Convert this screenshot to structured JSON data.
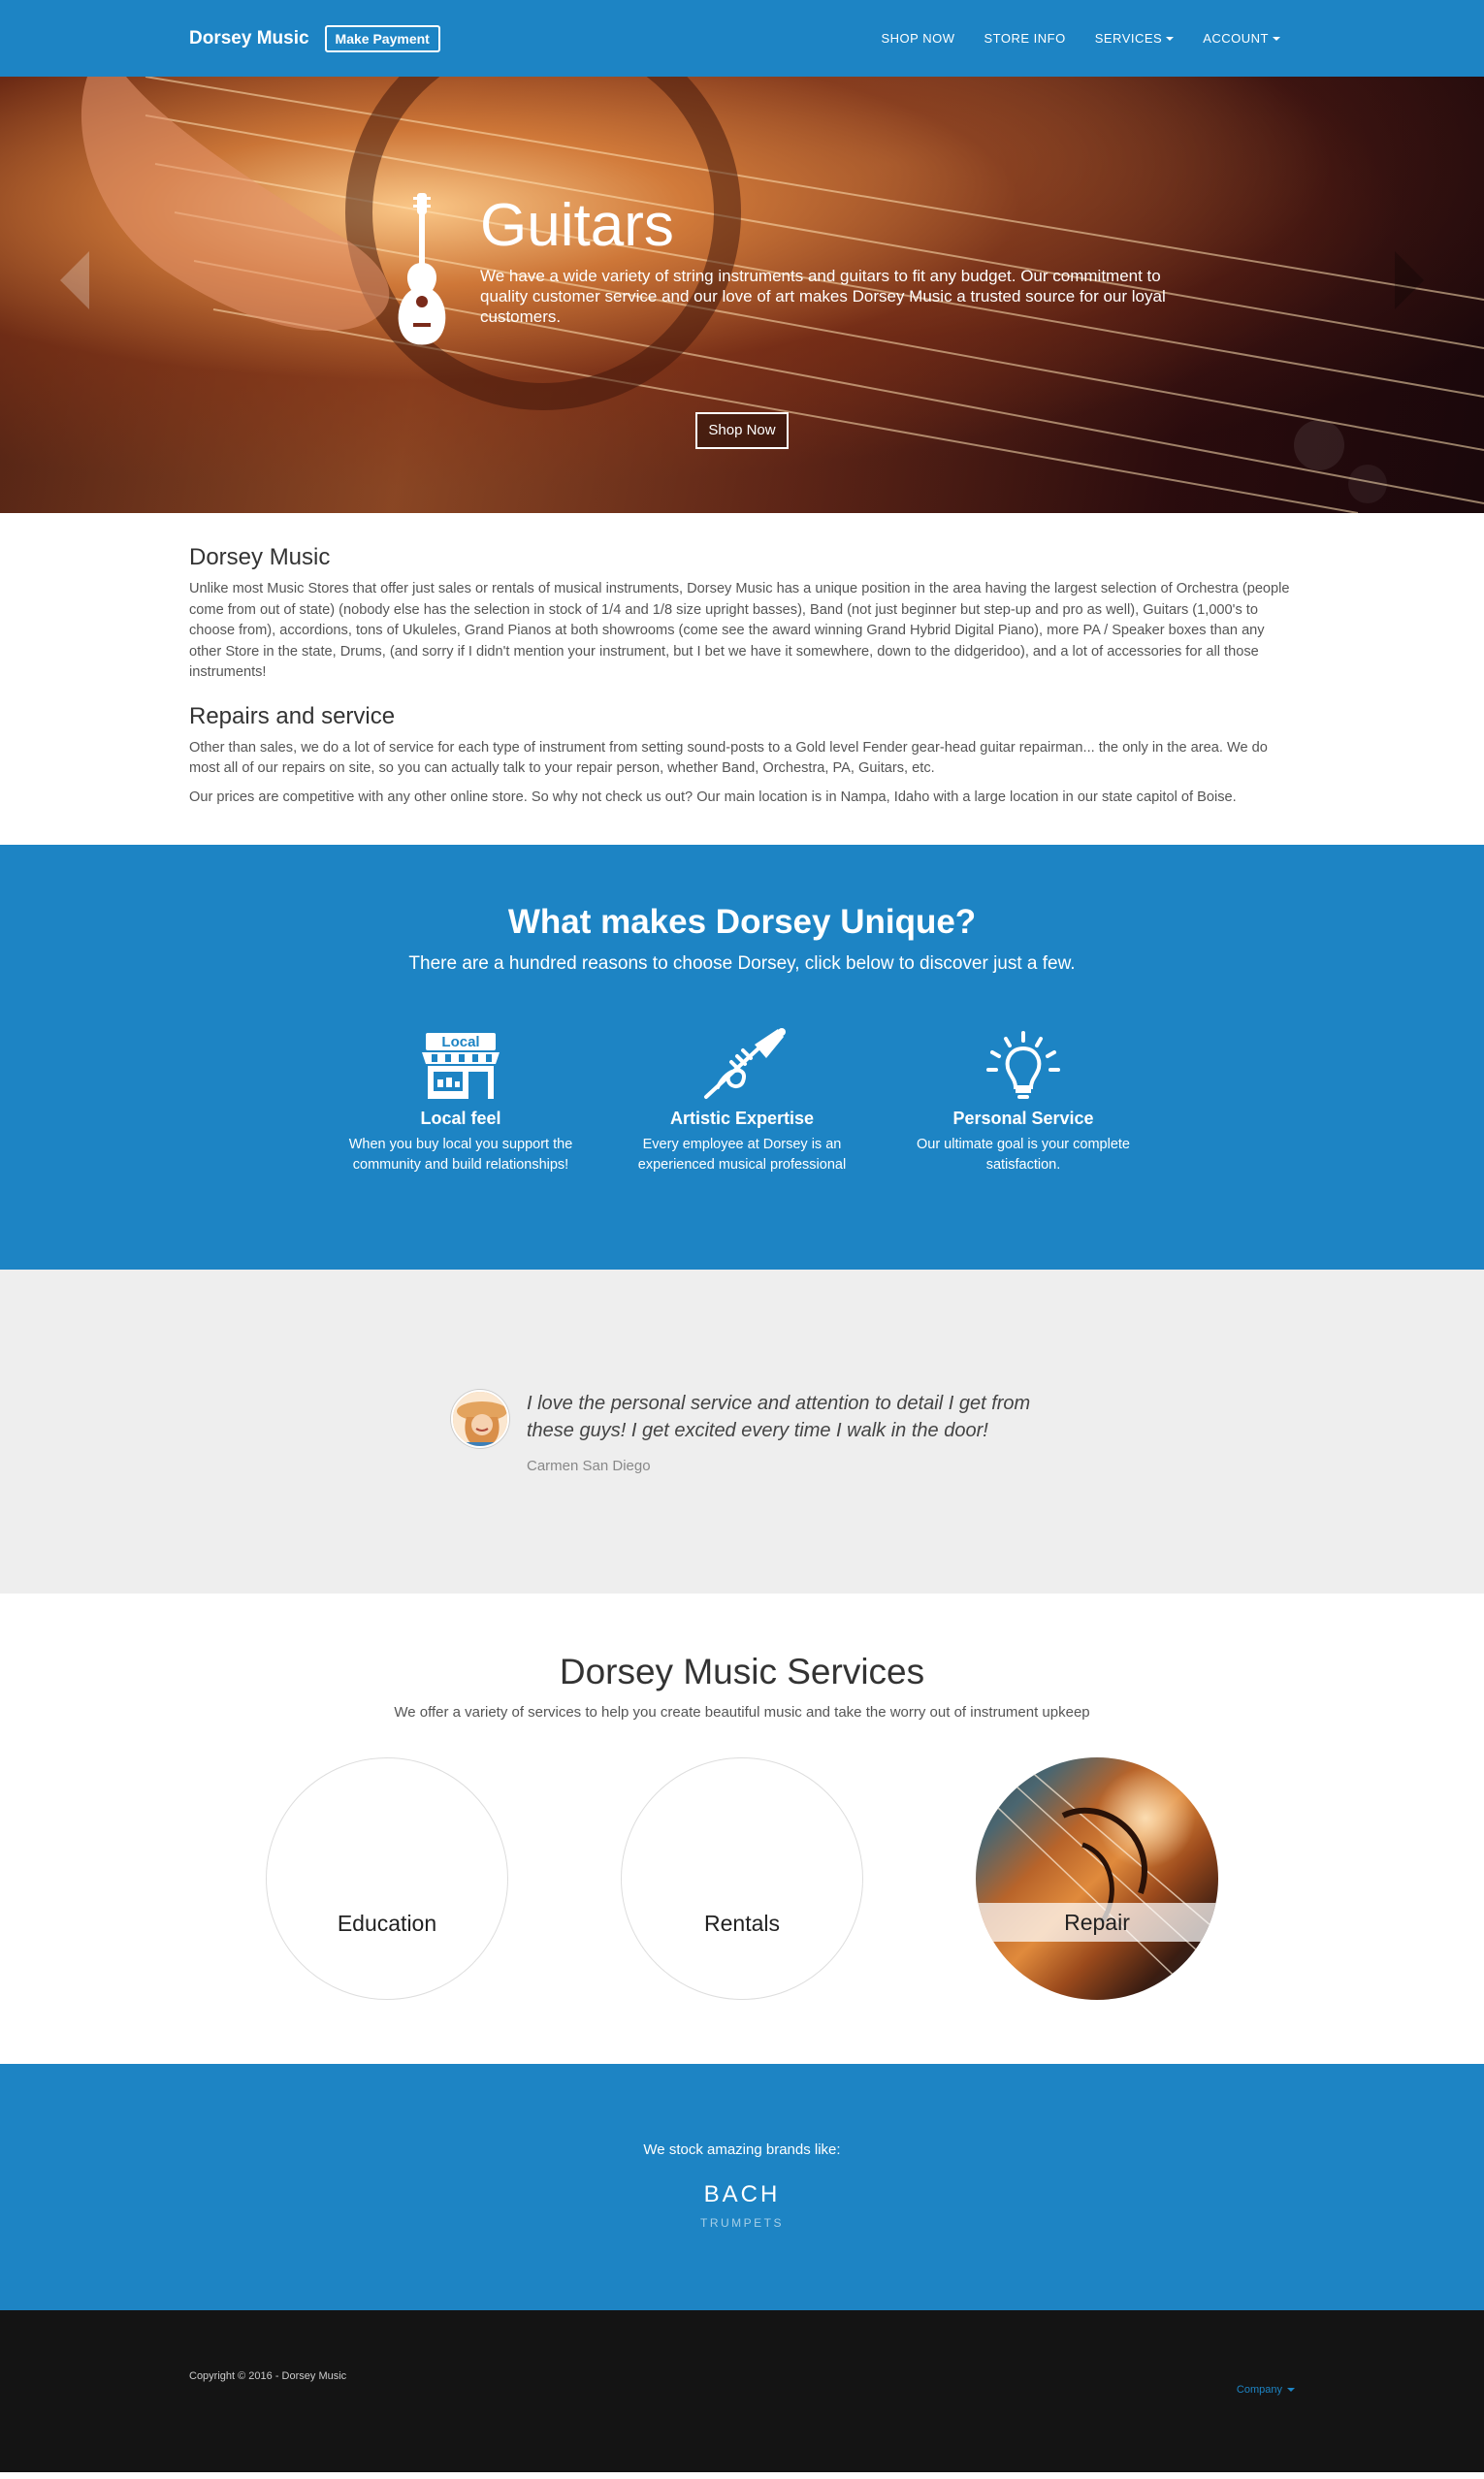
{
  "nav": {
    "brand": "Dorsey Music",
    "pay_label": "Make Payment",
    "links": [
      "SHOP NOW",
      "STORE INFO",
      "SERVICES",
      "ACCOUNT"
    ]
  },
  "hero": {
    "title": "Guitars",
    "text": "We have a wide variety of string instruments and guitars to fit any budget. Our commitment to quality customer service and our love of art makes Dorsey Music a trusted source for our loyal customers.",
    "button": "Shop Now",
    "slide_count": 4,
    "active_slide": 1
  },
  "about": {
    "title": "Dorsey Music",
    "body": "Unlike most Music Stores that offer just sales or rentals of musical instruments, Dorsey Music has a unique position in the area having the largest selection of Orchestra (people come from out of state) (nobody else has the selection in stock of 1/4 and 1/8 size upright basses), Band (not just beginner but step-up and pro as well), Guitars (1,000's to choose from), accordions, tons of Ukuleles, Grand Pianos at both showrooms (come see the award winning Grand Hybrid Digital Piano), more PA / Speaker boxes than any other Store in the state, Drums, (and sorry if I didn't mention your instrument, but I bet we have it somewhere, down to the didgeridoo), and a lot of accessories for all those instruments!",
    "repairs_title": "Repairs and service",
    "repairs_body": "Other than sales, we do a lot of service for each type of instrument from setting sound-posts to a Gold level Fender gear-head guitar repairman... the only in the area. We do most all of our repairs on site, so you can actually talk to your repair person, whether Band, Orchestra, PA, Guitars, etc.",
    "prices_body": "Our prices are competitive with any other online store. So why not check us out? Our main location is in Nampa, Idaho with a large location in our state capitol of Boise."
  },
  "unique": {
    "title": "What makes Dorsey Unique?",
    "subtitle": "There are a hundred reasons to choose Dorsey, click below to discover just a few.",
    "features": [
      {
        "title": "Local feel",
        "text": "When you buy local you support the community and build relationships!",
        "icon": "local-store-icon",
        "icon_text": "Local"
      },
      {
        "title": "Artistic Expertise",
        "text": "Every employee at Dorsey is an experienced musical professional",
        "icon": "trumpet-icon"
      },
      {
        "title": "Personal Service",
        "text": "Our ultimate goal is your complete satisfaction.",
        "icon": "lightbulb-icon"
      }
    ]
  },
  "testimonial": {
    "quote": "I love the personal service and attention to detail I get from these guys! I get excited every time I walk in the door!",
    "author": "Carmen San Diego"
  },
  "services": {
    "title": "Dorsey Music Services",
    "subtitle": "We offer a variety of services to help you create beautiful music and take the worry out of instrument upkeep",
    "items": [
      "Education",
      "Rentals",
      "Repair"
    ]
  },
  "brands": {
    "intro": "We stock amazing brands like:",
    "name": "BACH",
    "category": "TRUMPETS"
  },
  "footer": {
    "copyright": "Copyright © 2016 - Dorsey Music",
    "company": "Company"
  },
  "colors": {
    "primary": "#1d84c4",
    "footer_bg": "#141414",
    "testimonial_bg": "#eeeeee"
  }
}
